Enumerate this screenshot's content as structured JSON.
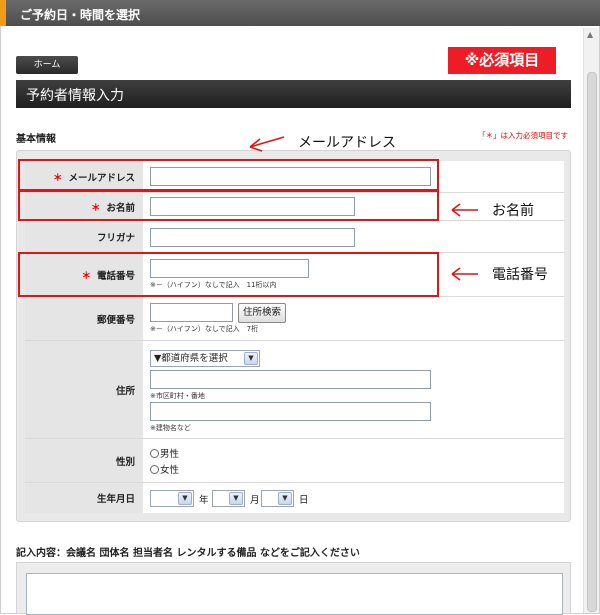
{
  "window": {
    "title": "ご予約日・時間を選択"
  },
  "nav": {
    "home_label": "ホーム"
  },
  "badge": {
    "required_items": "※必須項目"
  },
  "section": {
    "title": "予約者情報入力"
  },
  "basic_info": {
    "heading": "基本情報",
    "required_note": "「＊」は入力必須項目です"
  },
  "form": {
    "email": {
      "label": "メールアドレス",
      "required_mark": "＊",
      "value": ""
    },
    "name": {
      "label": "お名前",
      "required_mark": "＊",
      "value": ""
    },
    "furigana": {
      "label": "フリガナ",
      "value": ""
    },
    "phone": {
      "label": "電話番号",
      "required_mark": "＊",
      "value": "",
      "hint": "※－（ハイフン）なしで記入　11桁以内"
    },
    "postal": {
      "label": "郵便番号",
      "value": "",
      "search_button": "住所検索",
      "hint": "※－（ハイフン）なしで記入　7桁"
    },
    "address": {
      "label": "住所",
      "prefecture_select": "▼都道府県を選択",
      "line1_hint": "※市区町村・番地",
      "line2_hint": "※建物名など"
    },
    "gender": {
      "label": "性別",
      "options": [
        "男性",
        "女性"
      ]
    },
    "birthdate": {
      "label": "生年月日",
      "year_unit": "年",
      "month_unit": "月",
      "day_unit": "日"
    }
  },
  "annotations": {
    "email": "メールアドレス",
    "name": "お名前",
    "phone": "電話番号"
  },
  "memo": {
    "label": "記入内容：会議名 団体名 担当者名 レンタルする備品 などをご記入ください",
    "value": ""
  },
  "colors": {
    "required_red": "#ee1c24",
    "tab_accent": "#f29a1a",
    "annotation_red": "#e21414"
  }
}
